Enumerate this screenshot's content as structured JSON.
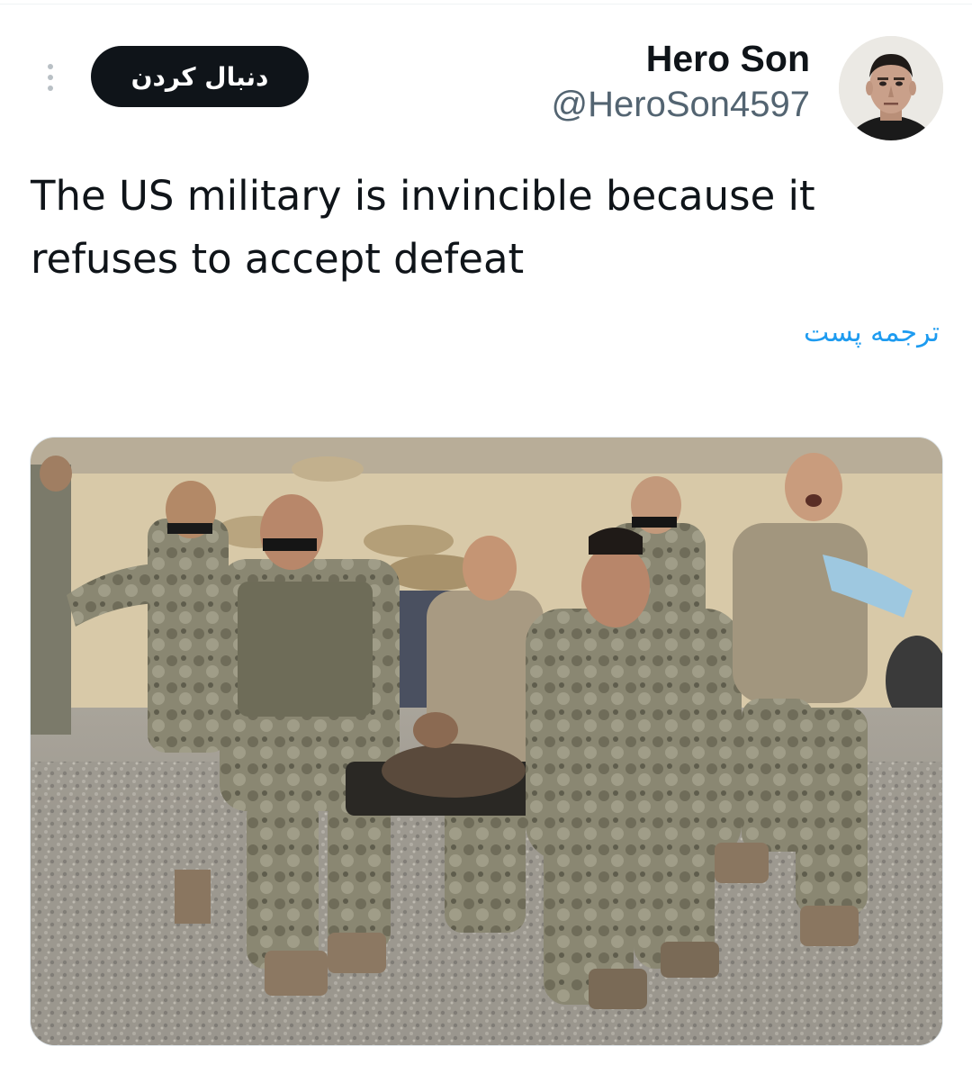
{
  "post": {
    "author": {
      "display_name": "Hero Son",
      "handle": "@HeroSon4597",
      "avatar_icon": "profile-avatar-photo"
    },
    "follow_label": "دنبال کردن",
    "more_icon": "vertical-ellipsis-icon",
    "text_line1": "The US military is invincible because it",
    "text_line2": "refuses to accept defeat",
    "translate_label": "ترجمه پست",
    "media": {
      "type": "photo",
      "subject": "soldiers carrying a casualty on a stretcher"
    }
  },
  "colors": {
    "primary_text": "#0f1419",
    "secondary_text": "#536471",
    "link": "#1d9bf0",
    "follow_button_bg": "#0f1419",
    "follow_button_text": "#ffffff"
  }
}
